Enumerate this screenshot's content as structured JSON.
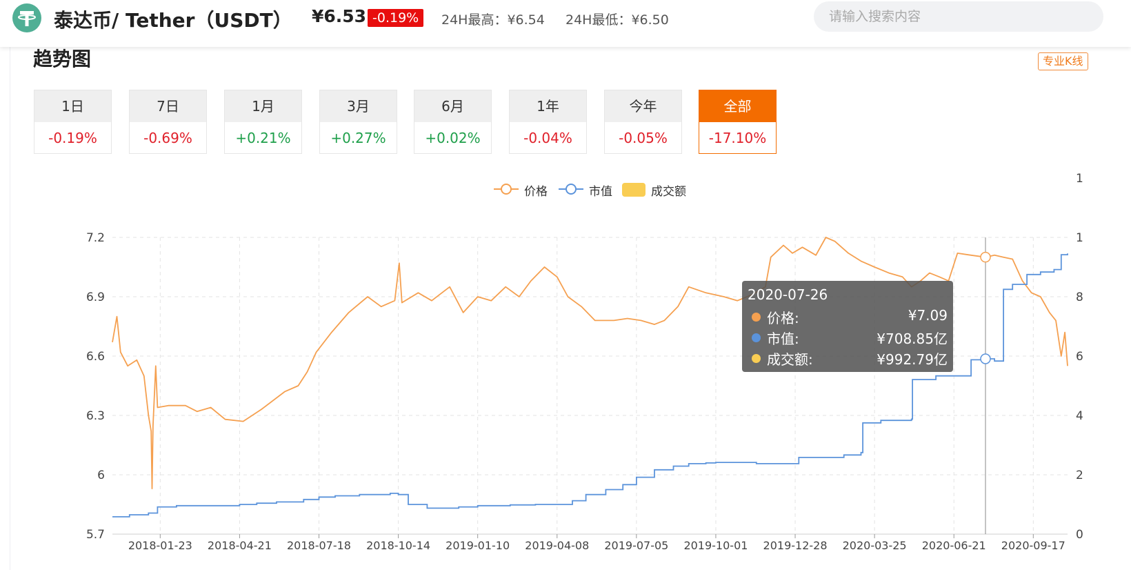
{
  "header": {
    "coin_name": "泰达币/ Tether（USDT）",
    "price": "¥6.53",
    "change": "-0.19%",
    "high_24h": "24H最高：¥6.54",
    "low_24h": "24H最低：¥6.50",
    "search_placeholder": "请输入搜索内容",
    "logo_icon": "tether-logo-icon",
    "colors": {
      "brand": "#50af95",
      "badge": "#e80e0e",
      "accent": "#f36c00"
    }
  },
  "section": {
    "title": "趋势图",
    "pro_kline_label": "专业K线"
  },
  "ranges": [
    {
      "label": "1日",
      "change": "-0.19%",
      "dir": "neg"
    },
    {
      "label": "7日",
      "change": "-0.69%",
      "dir": "neg"
    },
    {
      "label": "1月",
      "change": "+0.21%",
      "dir": "pos"
    },
    {
      "label": "3月",
      "change": "+0.27%",
      "dir": "pos"
    },
    {
      "label": "6月",
      "change": "+0.02%",
      "dir": "pos"
    },
    {
      "label": "1年",
      "change": "-0.04%",
      "dir": "neg"
    },
    {
      "label": "今年",
      "change": "-0.05%",
      "dir": "neg"
    },
    {
      "label": "全部",
      "change": "-17.10%",
      "dir": "neg",
      "active": true
    }
  ],
  "legend": [
    {
      "name": "价格",
      "color": "#f5a050",
      "style": "line-circle"
    },
    {
      "name": "市值",
      "color": "#5b93db",
      "style": "line-circle"
    },
    {
      "name": "成交额",
      "color": "#f9cd53",
      "style": "box"
    }
  ],
  "tooltip": {
    "date": "2020-07-26",
    "rows": [
      {
        "name": "价格:",
        "value": "¥7.09",
        "color": "#f5a050"
      },
      {
        "name": "市值:",
        "value": "¥708.85亿",
        "color": "#5b93db"
      },
      {
        "name": "成交额:",
        "value": "¥992.79亿",
        "color": "#f9cd53"
      }
    ]
  },
  "chart_data": {
    "type": "line",
    "title": "",
    "grid": true,
    "y_left": {
      "ticks": [
        "7.2",
        "6.9",
        "6.6",
        "6.3",
        "6",
        "5.7"
      ],
      "range": [
        5.7,
        7.2
      ]
    },
    "y_right": {
      "ticks": [
        "0",
        "2",
        "4",
        "6",
        "8",
        "1",
        "1"
      ],
      "range_market_cap_yi": [
        0,
        1200
      ],
      "note": "right axis tick labels are cut off at the right edge"
    },
    "x_ticks": [
      "2018-01-23",
      "2018-04-21",
      "2018-07-18",
      "2018-10-14",
      "2019-01-10",
      "2019-04-08",
      "2019-07-05",
      "2019-10-01",
      "2019-12-28",
      "2020-03-25",
      "2020-06-21",
      "2020-09-17"
    ],
    "x_range": [
      "2017-12-01",
      "2020-10-25"
    ],
    "series": [
      {
        "name": "价格",
        "color": "#f5a050",
        "points": [
          [
            "2017-12-01",
            6.67
          ],
          [
            "2017-12-06",
            6.8
          ],
          [
            "2017-12-10",
            6.62
          ],
          [
            "2017-12-18",
            6.55
          ],
          [
            "2017-12-28",
            6.58
          ],
          [
            "2018-01-05",
            6.5
          ],
          [
            "2018-01-10",
            6.3
          ],
          [
            "2018-01-13",
            6.22
          ],
          [
            "2018-01-14",
            5.93
          ],
          [
            "2018-01-15",
            6.25
          ],
          [
            "2018-01-18",
            6.55
          ],
          [
            "2018-01-20",
            6.34
          ],
          [
            "2018-02-01",
            6.35
          ],
          [
            "2018-02-20",
            6.35
          ],
          [
            "2018-03-05",
            6.32
          ],
          [
            "2018-03-20",
            6.34
          ],
          [
            "2018-04-05",
            6.28
          ],
          [
            "2018-04-25",
            6.27
          ],
          [
            "2018-05-15",
            6.33
          ],
          [
            "2018-06-10",
            6.42
          ],
          [
            "2018-06-25",
            6.45
          ],
          [
            "2018-07-05",
            6.52
          ],
          [
            "2018-07-15",
            6.62
          ],
          [
            "2018-08-01",
            6.72
          ],
          [
            "2018-08-20",
            6.82
          ],
          [
            "2018-09-10",
            6.9
          ],
          [
            "2018-09-25",
            6.85
          ],
          [
            "2018-10-10",
            6.88
          ],
          [
            "2018-10-15",
            7.07
          ],
          [
            "2018-10-18",
            6.87
          ],
          [
            "2018-11-05",
            6.92
          ],
          [
            "2018-11-20",
            6.88
          ],
          [
            "2018-12-10",
            6.95
          ],
          [
            "2018-12-25",
            6.82
          ],
          [
            "2019-01-10",
            6.9
          ],
          [
            "2019-01-25",
            6.88
          ],
          [
            "2019-02-10",
            6.95
          ],
          [
            "2019-02-25",
            6.9
          ],
          [
            "2019-03-10",
            6.98
          ],
          [
            "2019-03-25",
            7.05
          ],
          [
            "2019-04-08",
            7.0
          ],
          [
            "2019-04-20",
            6.9
          ],
          [
            "2019-05-05",
            6.85
          ],
          [
            "2019-05-20",
            6.78
          ],
          [
            "2019-06-10",
            6.78
          ],
          [
            "2019-06-25",
            6.79
          ],
          [
            "2019-07-10",
            6.78
          ],
          [
            "2019-07-25",
            6.76
          ],
          [
            "2019-08-05",
            6.78
          ],
          [
            "2019-08-20",
            6.85
          ],
          [
            "2019-09-01",
            6.95
          ],
          [
            "2019-09-20",
            6.92
          ],
          [
            "2019-10-10",
            6.9
          ],
          [
            "2019-10-25",
            6.88
          ],
          [
            "2019-11-10",
            6.91
          ],
          [
            "2019-11-25",
            6.95
          ],
          [
            "2019-12-01",
            7.1
          ],
          [
            "2019-12-15",
            7.16
          ],
          [
            "2019-12-25",
            7.12
          ],
          [
            "2020-01-05",
            7.15
          ],
          [
            "2020-01-20",
            7.11
          ],
          [
            "2020-01-31",
            7.2
          ],
          [
            "2020-02-10",
            7.18
          ],
          [
            "2020-02-25",
            7.12
          ],
          [
            "2020-03-10",
            7.08
          ],
          [
            "2020-03-25",
            7.05
          ],
          [
            "2020-04-10",
            7.02
          ],
          [
            "2020-04-25",
            7.0
          ],
          [
            "2020-05-05",
            6.95
          ],
          [
            "2020-05-15",
            6.98
          ],
          [
            "2020-05-25",
            7.02
          ],
          [
            "2020-06-05",
            7.0
          ],
          [
            "2020-06-15",
            6.98
          ],
          [
            "2020-06-25",
            7.12
          ],
          [
            "2020-07-10",
            7.11
          ],
          [
            "2020-07-26",
            7.1
          ],
          [
            "2020-08-05",
            7.11
          ],
          [
            "2020-08-15",
            7.1
          ],
          [
            "2020-08-25",
            7.09
          ],
          [
            "2020-09-05",
            6.98
          ],
          [
            "2020-09-15",
            6.92
          ],
          [
            "2020-09-25",
            6.9
          ],
          [
            "2020-10-05",
            6.82
          ],
          [
            "2020-10-12",
            6.78
          ],
          [
            "2020-10-18",
            6.6
          ],
          [
            "2020-10-22",
            6.72
          ],
          [
            "2020-10-25",
            6.55
          ]
        ]
      },
      {
        "name": "市值",
        "color": "#5b93db",
        "unit": "亿",
        "points": [
          [
            "2017-12-01",
            70
          ],
          [
            "2017-12-20",
            78
          ],
          [
            "2018-01-10",
            85
          ],
          [
            "2018-01-20",
            110
          ],
          [
            "2018-02-10",
            115
          ],
          [
            "2018-03-20",
            115
          ],
          [
            "2018-04-21",
            120
          ],
          [
            "2018-05-10",
            125
          ],
          [
            "2018-06-01",
            130
          ],
          [
            "2018-07-01",
            140
          ],
          [
            "2018-07-18",
            150
          ],
          [
            "2018-08-05",
            155
          ],
          [
            "2018-09-01",
            160
          ],
          [
            "2018-10-05",
            165
          ],
          [
            "2018-10-14",
            160
          ],
          [
            "2018-10-25",
            120
          ],
          [
            "2018-11-15",
            105
          ],
          [
            "2018-12-20",
            110
          ],
          [
            "2019-01-10",
            115
          ],
          [
            "2019-02-15",
            118
          ],
          [
            "2019-03-15",
            120
          ],
          [
            "2019-04-08",
            120
          ],
          [
            "2019-04-25",
            135
          ],
          [
            "2019-05-10",
            160
          ],
          [
            "2019-06-01",
            180
          ],
          [
            "2019-06-20",
            200
          ],
          [
            "2019-07-05",
            230
          ],
          [
            "2019-07-25",
            260
          ],
          [
            "2019-08-15",
            275
          ],
          [
            "2019-09-01",
            285
          ],
          [
            "2019-09-20",
            288
          ],
          [
            "2019-10-01",
            290
          ],
          [
            "2019-11-15",
            285
          ],
          [
            "2019-12-28",
            285
          ],
          [
            "2020-01-01",
            310
          ],
          [
            "2020-02-20",
            320
          ],
          [
            "2020-03-10",
            330
          ],
          [
            "2020-03-12",
            450
          ],
          [
            "2020-04-01",
            460
          ],
          [
            "2020-05-05",
            465
          ],
          [
            "2020-05-06",
            625
          ],
          [
            "2020-06-01",
            640
          ],
          [
            "2020-06-30",
            640
          ],
          [
            "2020-07-10",
            705
          ],
          [
            "2020-07-26",
            708.85
          ],
          [
            "2020-08-05",
            700
          ],
          [
            "2020-08-15",
            990
          ],
          [
            "2020-08-25",
            1010
          ],
          [
            "2020-09-10",
            1050
          ],
          [
            "2020-09-25",
            1060
          ],
          [
            "2020-10-10",
            1070
          ],
          [
            "2020-10-18",
            1130
          ],
          [
            "2020-10-25",
            1135
          ]
        ]
      },
      {
        "name": "成交额",
        "color": "#f9cd53",
        "unit": "亿",
        "points": [
          [
            "2020-07-26",
            992.79
          ]
        ]
      }
    ],
    "crosshair_date": "2020-07-26"
  }
}
